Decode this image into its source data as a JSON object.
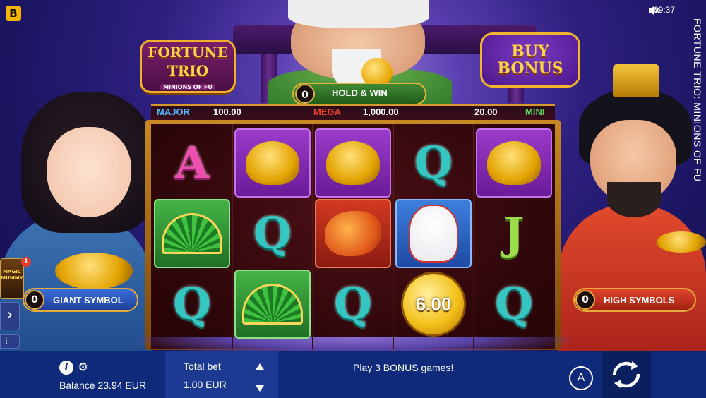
{
  "app": {
    "title": "FORTUNE TRIO: MINIONS OF FU",
    "brand_letter": "B",
    "clock": "09:37"
  },
  "logo": {
    "line1": "FORTUNE",
    "line2": "TRIO",
    "line3": "MINIONS OF FU"
  },
  "buy_bonus": {
    "line1": "BUY",
    "line2": "BONUS"
  },
  "hold_and_win": {
    "count": "0",
    "label": "HOLD & WIN"
  },
  "jackpots": {
    "major": {
      "label": "MAJOR",
      "value": "100.00"
    },
    "mega": {
      "label": "MEGA",
      "value": "1,000.00"
    },
    "mini": {
      "label": "MINI",
      "value": "20.00"
    }
  },
  "reels": [
    [
      {
        "symbol": "A",
        "type": "letter"
      },
      {
        "symbol": "fan-icon",
        "type": "picture",
        "bg": "green"
      },
      {
        "symbol": "Q",
        "type": "letter"
      }
    ],
    [
      {
        "symbol": "gold-ingot-icon",
        "type": "picture",
        "bg": "purple"
      },
      {
        "symbol": "Q",
        "type": "letter"
      },
      {
        "symbol": "fan-icon",
        "type": "picture",
        "bg": "green"
      }
    ],
    [
      {
        "symbol": "gold-ingot-icon",
        "type": "picture",
        "bg": "purple"
      },
      {
        "symbol": "koi-fish-icon",
        "type": "picture",
        "bg": "red"
      },
      {
        "symbol": "Q",
        "type": "letter"
      }
    ],
    [
      {
        "symbol": "Q",
        "type": "letter"
      },
      {
        "symbol": "lucky-cat-icon",
        "type": "picture",
        "bg": "blue"
      },
      {
        "symbol": "6.00",
        "type": "coin"
      }
    ],
    [
      {
        "symbol": "gold-ingot-icon",
        "type": "picture",
        "bg": "purple"
      },
      {
        "symbol": "J",
        "type": "letter"
      },
      {
        "symbol": "Q",
        "type": "letter"
      }
    ]
  ],
  "giant_symbol": {
    "count": "0",
    "label": "GIANT SYMBOL"
  },
  "high_symbols": {
    "count": "0",
    "label": "HIGH SYMBOLS"
  },
  "promo": {
    "title": "MAGIC MUMMY",
    "badge": "1"
  },
  "sidebar": {
    "expand_glyph": "›",
    "menu_glyph": "⋮⋮"
  },
  "bottom": {
    "balance": "Balance 23.94 EUR",
    "total_bet_label": "Total bet",
    "total_bet_value": "1.00 EUR",
    "message": "Play 3 BONUS games!",
    "autoplay_label": "A"
  },
  "colors": {
    "accent": "#f3b42d",
    "bottom_bar": "#0f2a7a",
    "mega": "#e8452c",
    "mini": "#5fd15a"
  }
}
